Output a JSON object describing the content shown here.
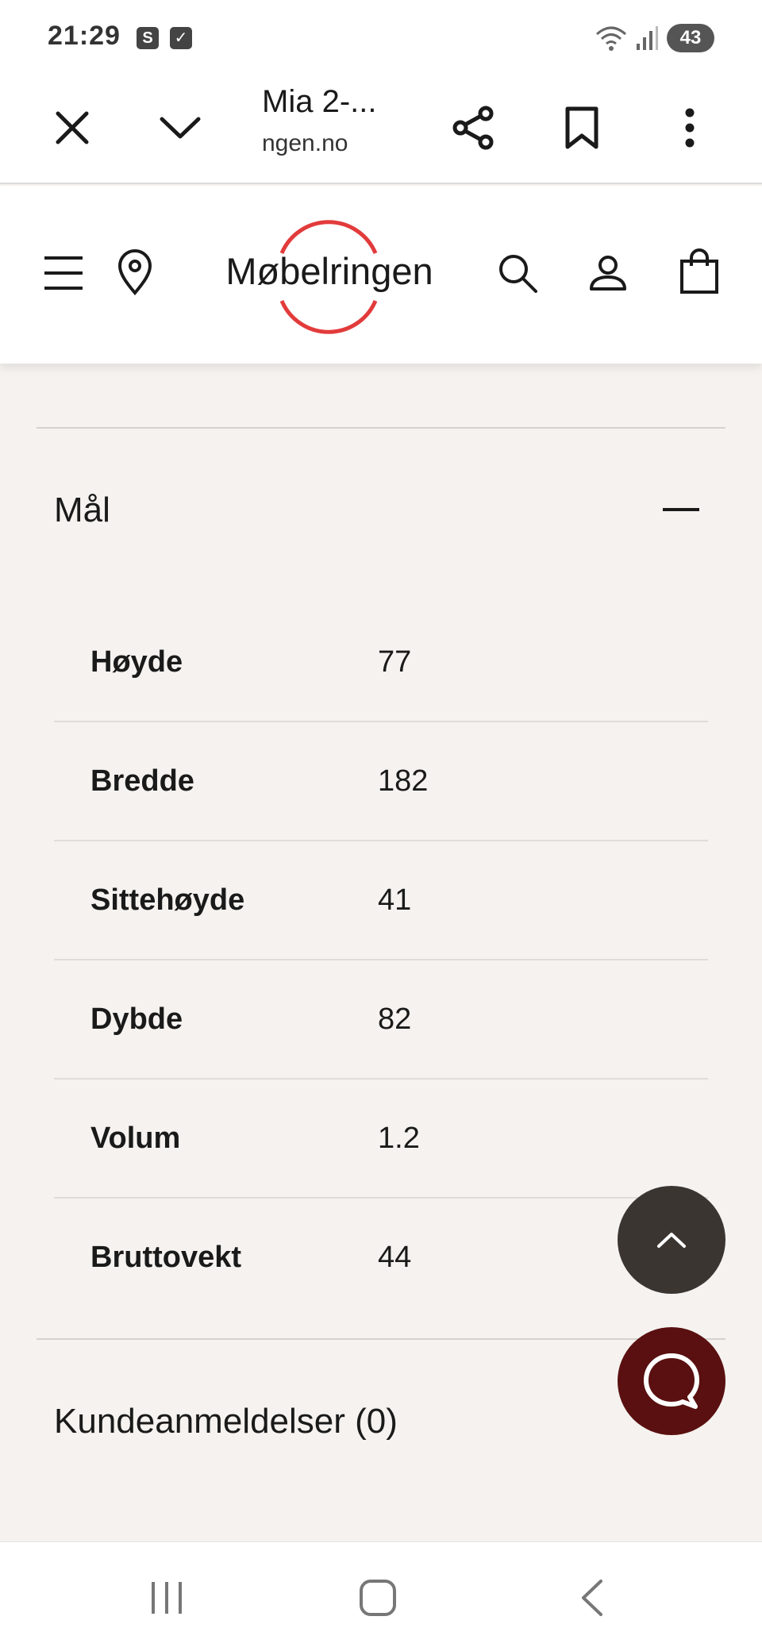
{
  "status_bar": {
    "time": "21:29",
    "app_icons": [
      "S",
      "✓"
    ],
    "battery": "43"
  },
  "browser": {
    "title": "Mia 2-...",
    "domain": "ngen.no"
  },
  "site": {
    "logo_text": "Møbelringen",
    "brand_color": "#e23b3b"
  },
  "measurements": {
    "title": "Mål",
    "rows": [
      {
        "label": "Høyde",
        "value": "77"
      },
      {
        "label": "Bredde",
        "value": "182"
      },
      {
        "label": "Sittehøyde",
        "value": "41"
      },
      {
        "label": "Dybde",
        "value": "82"
      },
      {
        "label": "Volum",
        "value": "1.2"
      },
      {
        "label": "Bruttovekt",
        "value": "44"
      }
    ]
  },
  "reviews": {
    "title": "Kundeanmeldelser (0)"
  },
  "colors": {
    "background": "#f5f2ef",
    "scroll_top_button": "#3b3532",
    "chat_button": "#5a1010"
  }
}
